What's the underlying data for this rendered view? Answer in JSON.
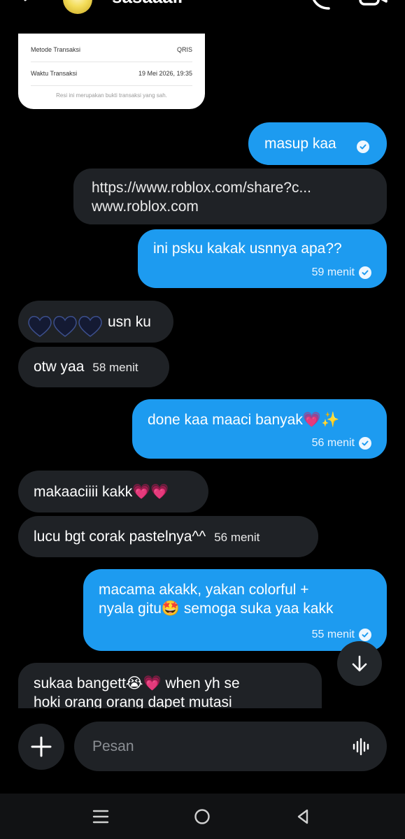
{
  "header": {
    "contact_name": "sasaaaii"
  },
  "receipt": {
    "rows": [
      {
        "label": "Metode Transaksi",
        "value": "QRIS"
      },
      {
        "label": "Waktu Transaksi",
        "value": "19 Mei 2026, 19:35"
      }
    ],
    "note": "Resi ini merupakan bukti transaksi yang sah."
  },
  "messages": [
    {
      "direction": "out",
      "text": "masup kaa",
      "time": ""
    },
    {
      "direction": "in",
      "link_url": "https://www.roblox.com/share?c...",
      "link_domain": "www.roblox.com"
    },
    {
      "direction": "out",
      "text": "ini psku kakak usnnya apa??",
      "time": "59 menit"
    },
    {
      "direction": "in",
      "text": "usn ku",
      "time": ""
    },
    {
      "direction": "in",
      "text": "otw yaa",
      "time": "58 menit"
    },
    {
      "direction": "out",
      "text": "done kaa maaci banyak💗✨",
      "time": "56 menit"
    },
    {
      "direction": "in",
      "text": "makaaciiii kakk💗💗",
      "time": ""
    },
    {
      "direction": "in",
      "text": "lucu bgt corak pastelnya^^",
      "time": "56 menit"
    },
    {
      "direction": "out",
      "text_line1": "macama akakk, yakan colorful +",
      "text_line2": "nyala gitu🤩 semoga suka yaa kakk",
      "time": "55 menit"
    },
    {
      "direction": "in",
      "text_line1": "sukaa bangett😭💗 when yh se",
      "text_line2": "hoki orang orang dapet mutasi",
      "time": ""
    }
  ],
  "composer": {
    "placeholder": "Pesan"
  },
  "colors": {
    "outgoing_bubble": "#1d9bf0",
    "incoming_bubble": "#1f2226",
    "background": "#000000"
  },
  "icons": [
    "back-arrow-icon",
    "phone-icon",
    "video-call-icon",
    "check-circle-icon",
    "black-heart-icon",
    "arrow-down-icon",
    "plus-icon",
    "voice-wave-icon",
    "nav-menu-icon",
    "nav-home-icon",
    "nav-back-icon"
  ]
}
